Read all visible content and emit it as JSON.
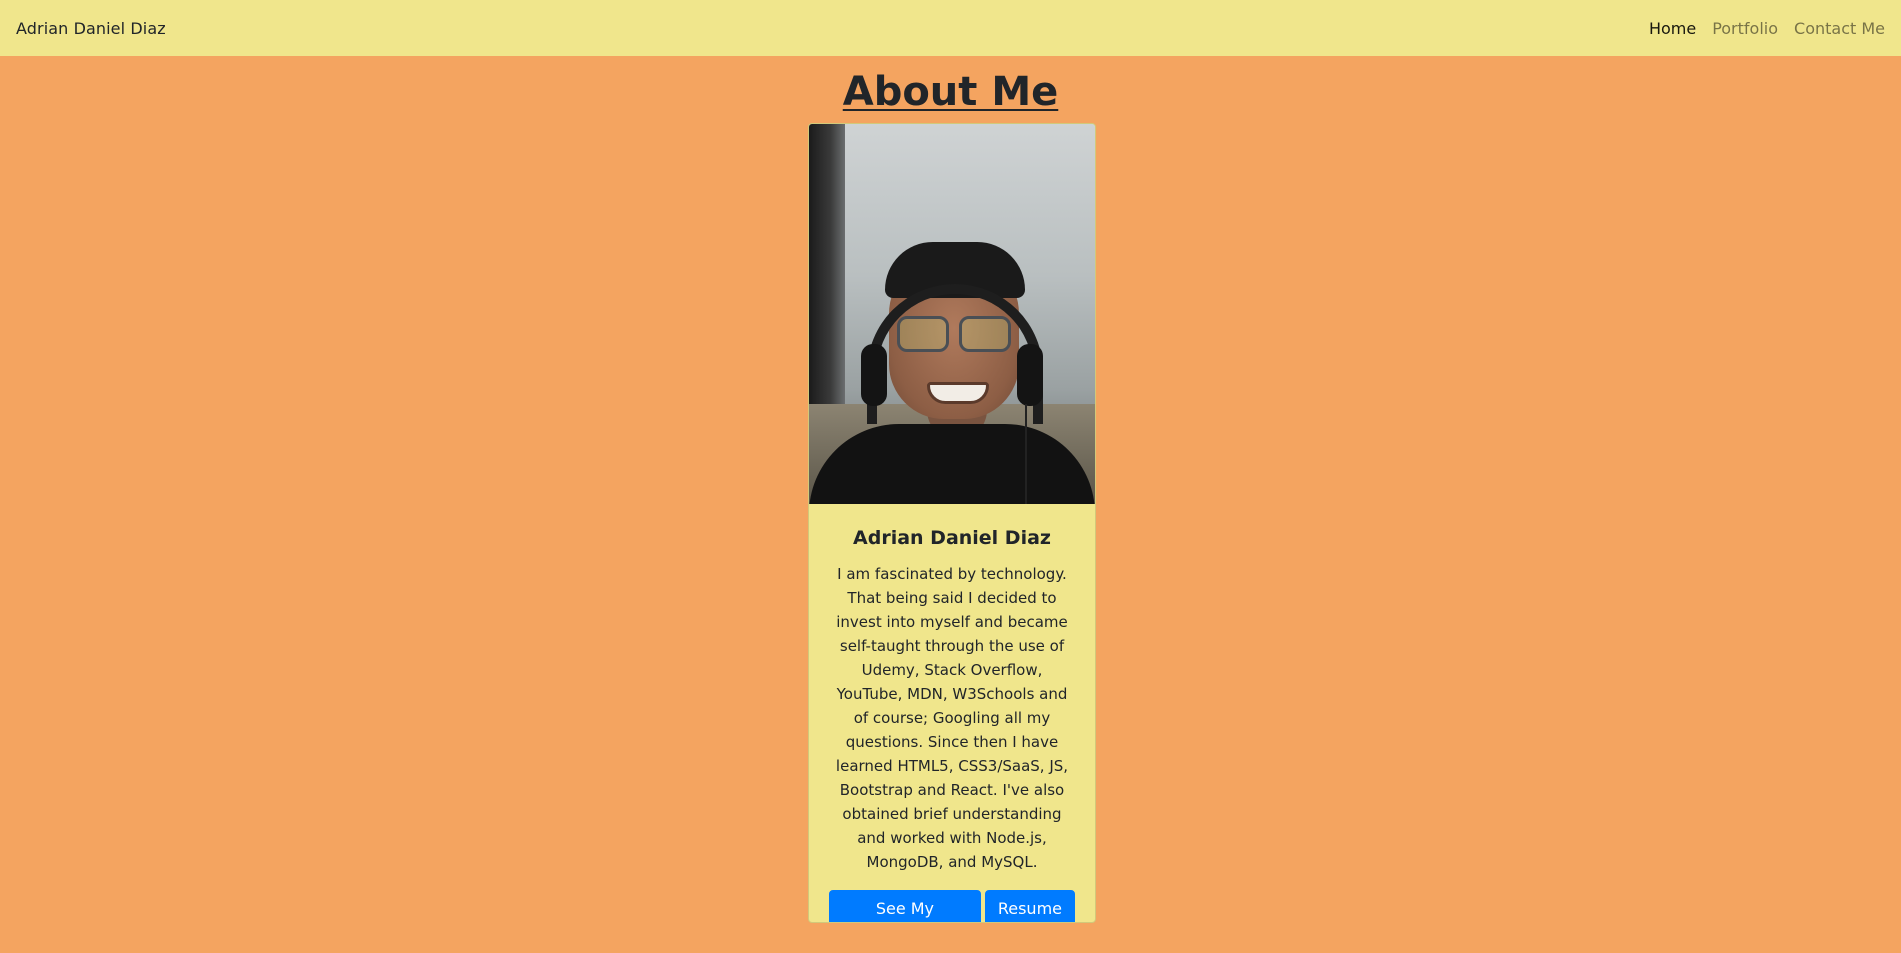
{
  "nav": {
    "brand": "Adrian Daniel Diaz",
    "links": [
      {
        "label": "Home",
        "active": true
      },
      {
        "label": "Portfolio",
        "active": false
      },
      {
        "label": "Contact Me",
        "active": false
      }
    ]
  },
  "page": {
    "title": "About Me"
  },
  "card": {
    "photo_alt": "Photo of Adrian Daniel Diaz",
    "name": "Adrian Daniel Diaz",
    "bio": "I am fascinated by technology. That being said I decided to invest into myself and became self-taught through the use of Udemy, Stack Overflow, YouTube, MDN, W3Schools and of course; Googling all my questions. Since then I have learned HTML5, CSS3/SaaS, JS, Bootstrap and React. I've also obtained brief understanding and worked with Node.js, MongoDB, and MySQL.",
    "buttons": {
      "portfolio": "See My Portfolio",
      "resume": "Resume"
    }
  },
  "colors": {
    "page_background": "#f4a460",
    "navbar_background": "#f0e68c",
    "card_background": "#f0e68c",
    "button_primary": "#007bff"
  }
}
